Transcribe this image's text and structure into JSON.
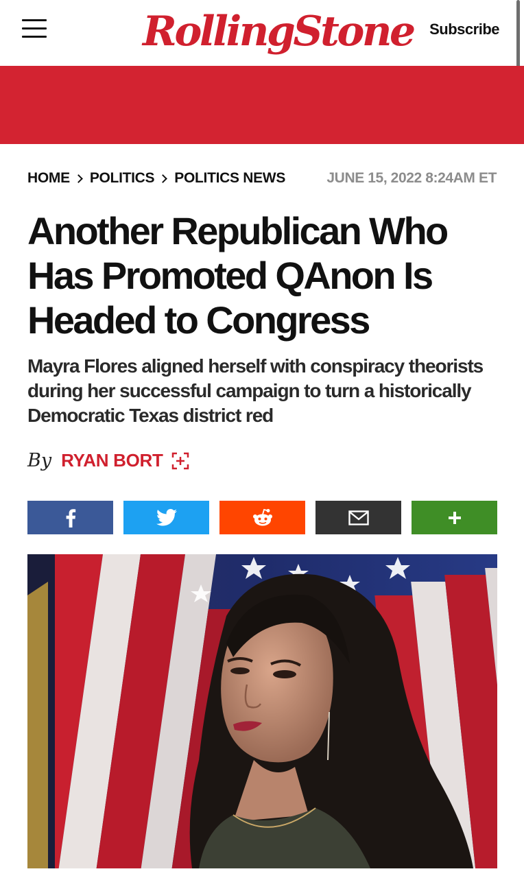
{
  "header": {
    "menu_icon": "hamburger-menu-icon",
    "logo_text": "RollingStone",
    "subscribe_label": "Subscribe"
  },
  "colors": {
    "brand_red": "#d32331",
    "facebook": "#3b5998",
    "twitter": "#1da1f2",
    "reddit": "#ff4500",
    "email": "#333333",
    "more": "#3f8e26"
  },
  "breadcrumb": {
    "items": [
      "HOME",
      "POLITICS",
      "POLITICS NEWS"
    ],
    "date": "JUNE 15, 2022 8:24AM ET"
  },
  "article": {
    "headline": "Another Republican Who Has Promoted QAnon Is Headed to Congress",
    "subheadline": "Mayra Flores aligned herself with conspiracy theorists during her successful campaign to turn a historically Democratic Texas district red",
    "by_label": "By",
    "author": "RYAN BORT",
    "follow_icon": "follow-author-plus-icon"
  },
  "share": [
    {
      "name": "facebook",
      "icon": "facebook-icon"
    },
    {
      "name": "twitter",
      "icon": "twitter-icon"
    },
    {
      "name": "reddit",
      "icon": "reddit-icon"
    },
    {
      "name": "email",
      "icon": "email-icon"
    },
    {
      "name": "more",
      "icon": "plus-icon"
    }
  ],
  "hero_image": {
    "description_icon": "photo-woman-in-front-of-american-flags"
  }
}
